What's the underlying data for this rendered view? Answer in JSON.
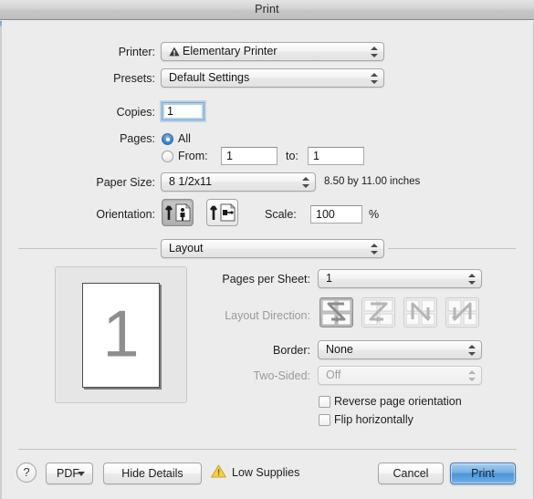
{
  "window": {
    "title": "Print"
  },
  "form": {
    "printer_label": "Printer:",
    "printer_value": "Elementary Printer",
    "printer_warning_icon": "warning-triangle-icon",
    "presets_label": "Presets:",
    "presets_value": "Default Settings",
    "copies_label": "Copies:",
    "copies_value": "1",
    "pages_label": "Pages:",
    "pages_all_label": "All",
    "pages_all_selected": true,
    "pages_from_label": "From:",
    "pages_from_value": "1",
    "pages_to_label": "to:",
    "pages_to_value": "1",
    "paper_size_label": "Paper Size:",
    "paper_size_value": "8 1/2x11",
    "paper_size_note": "8.50 by 11.00 inches",
    "orientation_label": "Orientation:",
    "orientation_portrait_icon": "portrait-orientation-icon",
    "orientation_landscape_icon": "landscape-orientation-icon",
    "orientation_selected": "portrait",
    "scale_label": "Scale:",
    "scale_value": "100",
    "scale_unit": "%"
  },
  "pane": {
    "selector_value": "Layout",
    "pages_per_sheet_label": "Pages per Sheet:",
    "pages_per_sheet_value": "1",
    "layout_direction_label": "Layout Direction:",
    "layout_directions": [
      {
        "icon": "layout-direction-z-icon",
        "selected": true
      },
      {
        "icon": "layout-direction-reverse-z-icon",
        "selected": false
      },
      {
        "icon": "layout-direction-n-icon",
        "selected": false
      },
      {
        "icon": "layout-direction-reverse-n-icon",
        "selected": false
      }
    ],
    "border_label": "Border:",
    "border_value": "None",
    "two_sided_label": "Two-Sided:",
    "two_sided_value": "Off",
    "two_sided_disabled": true,
    "reverse_page_orientation_label": "Reverse page orientation",
    "reverse_page_orientation_checked": false,
    "flip_horizontally_label": "Flip horizontally",
    "flip_horizontally_checked": false
  },
  "preview": {
    "page_number": "1"
  },
  "footer": {
    "help_label": "?",
    "pdf_label": "PDF",
    "hide_details_label": "Hide Details",
    "supplies_icon": "warning-triangle-icon",
    "supplies_label": "Low Supplies",
    "cancel_label": "Cancel",
    "print_label": "Print"
  },
  "colors": {
    "accent": "#4e95d8",
    "warning": "#f2c230",
    "window_bg": "#ececec",
    "radio_on": "#3d85c6"
  }
}
